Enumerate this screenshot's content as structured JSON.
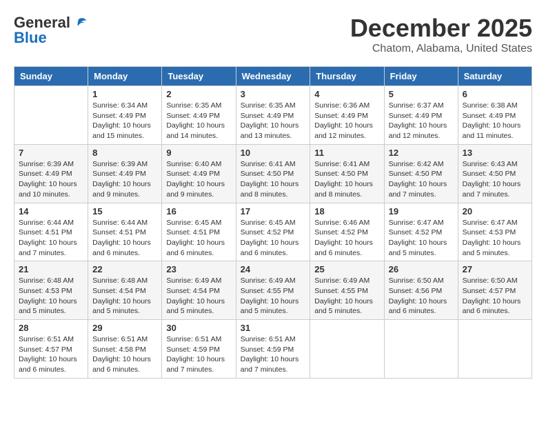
{
  "header": {
    "logo_line1": "General",
    "logo_line2": "Blue",
    "month": "December 2025",
    "location": "Chatom, Alabama, United States"
  },
  "weekdays": [
    "Sunday",
    "Monday",
    "Tuesday",
    "Wednesday",
    "Thursday",
    "Friday",
    "Saturday"
  ],
  "weeks": [
    [
      {
        "day": "",
        "info": ""
      },
      {
        "day": "1",
        "info": "Sunrise: 6:34 AM\nSunset: 4:49 PM\nDaylight: 10 hours\nand 15 minutes."
      },
      {
        "day": "2",
        "info": "Sunrise: 6:35 AM\nSunset: 4:49 PM\nDaylight: 10 hours\nand 14 minutes."
      },
      {
        "day": "3",
        "info": "Sunrise: 6:35 AM\nSunset: 4:49 PM\nDaylight: 10 hours\nand 13 minutes."
      },
      {
        "day": "4",
        "info": "Sunrise: 6:36 AM\nSunset: 4:49 PM\nDaylight: 10 hours\nand 12 minutes."
      },
      {
        "day": "5",
        "info": "Sunrise: 6:37 AM\nSunset: 4:49 PM\nDaylight: 10 hours\nand 12 minutes."
      },
      {
        "day": "6",
        "info": "Sunrise: 6:38 AM\nSunset: 4:49 PM\nDaylight: 10 hours\nand 11 minutes."
      }
    ],
    [
      {
        "day": "7",
        "info": "Sunrise: 6:39 AM\nSunset: 4:49 PM\nDaylight: 10 hours\nand 10 minutes."
      },
      {
        "day": "8",
        "info": "Sunrise: 6:39 AM\nSunset: 4:49 PM\nDaylight: 10 hours\nand 9 minutes."
      },
      {
        "day": "9",
        "info": "Sunrise: 6:40 AM\nSunset: 4:49 PM\nDaylight: 10 hours\nand 9 minutes."
      },
      {
        "day": "10",
        "info": "Sunrise: 6:41 AM\nSunset: 4:50 PM\nDaylight: 10 hours\nand 8 minutes."
      },
      {
        "day": "11",
        "info": "Sunrise: 6:41 AM\nSunset: 4:50 PM\nDaylight: 10 hours\nand 8 minutes."
      },
      {
        "day": "12",
        "info": "Sunrise: 6:42 AM\nSunset: 4:50 PM\nDaylight: 10 hours\nand 7 minutes."
      },
      {
        "day": "13",
        "info": "Sunrise: 6:43 AM\nSunset: 4:50 PM\nDaylight: 10 hours\nand 7 minutes."
      }
    ],
    [
      {
        "day": "14",
        "info": "Sunrise: 6:44 AM\nSunset: 4:51 PM\nDaylight: 10 hours\nand 7 minutes."
      },
      {
        "day": "15",
        "info": "Sunrise: 6:44 AM\nSunset: 4:51 PM\nDaylight: 10 hours\nand 6 minutes."
      },
      {
        "day": "16",
        "info": "Sunrise: 6:45 AM\nSunset: 4:51 PM\nDaylight: 10 hours\nand 6 minutes."
      },
      {
        "day": "17",
        "info": "Sunrise: 6:45 AM\nSunset: 4:52 PM\nDaylight: 10 hours\nand 6 minutes."
      },
      {
        "day": "18",
        "info": "Sunrise: 6:46 AM\nSunset: 4:52 PM\nDaylight: 10 hours\nand 6 minutes."
      },
      {
        "day": "19",
        "info": "Sunrise: 6:47 AM\nSunset: 4:52 PM\nDaylight: 10 hours\nand 5 minutes."
      },
      {
        "day": "20",
        "info": "Sunrise: 6:47 AM\nSunset: 4:53 PM\nDaylight: 10 hours\nand 5 minutes."
      }
    ],
    [
      {
        "day": "21",
        "info": "Sunrise: 6:48 AM\nSunset: 4:53 PM\nDaylight: 10 hours\nand 5 minutes."
      },
      {
        "day": "22",
        "info": "Sunrise: 6:48 AM\nSunset: 4:54 PM\nDaylight: 10 hours\nand 5 minutes."
      },
      {
        "day": "23",
        "info": "Sunrise: 6:49 AM\nSunset: 4:54 PM\nDaylight: 10 hours\nand 5 minutes."
      },
      {
        "day": "24",
        "info": "Sunrise: 6:49 AM\nSunset: 4:55 PM\nDaylight: 10 hours\nand 5 minutes."
      },
      {
        "day": "25",
        "info": "Sunrise: 6:49 AM\nSunset: 4:55 PM\nDaylight: 10 hours\nand 5 minutes."
      },
      {
        "day": "26",
        "info": "Sunrise: 6:50 AM\nSunset: 4:56 PM\nDaylight: 10 hours\nand 6 minutes."
      },
      {
        "day": "27",
        "info": "Sunrise: 6:50 AM\nSunset: 4:57 PM\nDaylight: 10 hours\nand 6 minutes."
      }
    ],
    [
      {
        "day": "28",
        "info": "Sunrise: 6:51 AM\nSunset: 4:57 PM\nDaylight: 10 hours\nand 6 minutes."
      },
      {
        "day": "29",
        "info": "Sunrise: 6:51 AM\nSunset: 4:58 PM\nDaylight: 10 hours\nand 6 minutes."
      },
      {
        "day": "30",
        "info": "Sunrise: 6:51 AM\nSunset: 4:59 PM\nDaylight: 10 hours\nand 7 minutes."
      },
      {
        "day": "31",
        "info": "Sunrise: 6:51 AM\nSunset: 4:59 PM\nDaylight: 10 hours\nand 7 minutes."
      },
      {
        "day": "",
        "info": ""
      },
      {
        "day": "",
        "info": ""
      },
      {
        "day": "",
        "info": ""
      }
    ]
  ]
}
